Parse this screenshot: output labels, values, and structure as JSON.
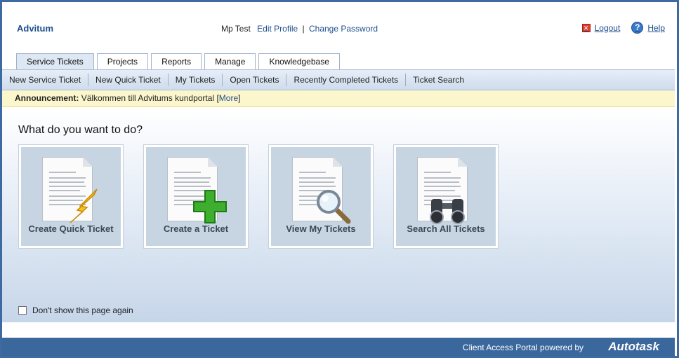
{
  "header": {
    "brand": "Advitum",
    "user_name": "Mp Test",
    "edit_profile": "Edit Profile",
    "separator": "|",
    "change_password": "Change Password",
    "logout": "Logout",
    "help": "Help"
  },
  "tabs": [
    {
      "label": "Service Tickets",
      "active": true
    },
    {
      "label": "Projects"
    },
    {
      "label": "Reports"
    },
    {
      "label": "Manage"
    },
    {
      "label": "Knowledgebase"
    }
  ],
  "subnav": [
    "New Service Ticket",
    "New Quick Ticket",
    "My Tickets",
    "Open Tickets",
    "Recently Completed Tickets",
    "Ticket Search"
  ],
  "announcement": {
    "label": "Announcement:",
    "text": "Välkommen till Advitums kundportal",
    "more": "More"
  },
  "main": {
    "question": "What do you want to do?",
    "cards": [
      {
        "label": "Create Quick Ticket",
        "icon": "lightning-icon"
      },
      {
        "label": "Create a Ticket",
        "icon": "plus-icon"
      },
      {
        "label": "View My Tickets",
        "icon": "magnifier-icon"
      },
      {
        "label": "Search All Tickets",
        "icon": "binoculars-icon"
      }
    ],
    "dont_show": "Don't show this page again"
  },
  "footer": {
    "text": "Client Access Portal powered by",
    "logo": "Autotask"
  },
  "colors": {
    "accent": "#1f4e8c",
    "footer_bg": "#3a679c",
    "announcement_bg": "#fbf6cc"
  }
}
